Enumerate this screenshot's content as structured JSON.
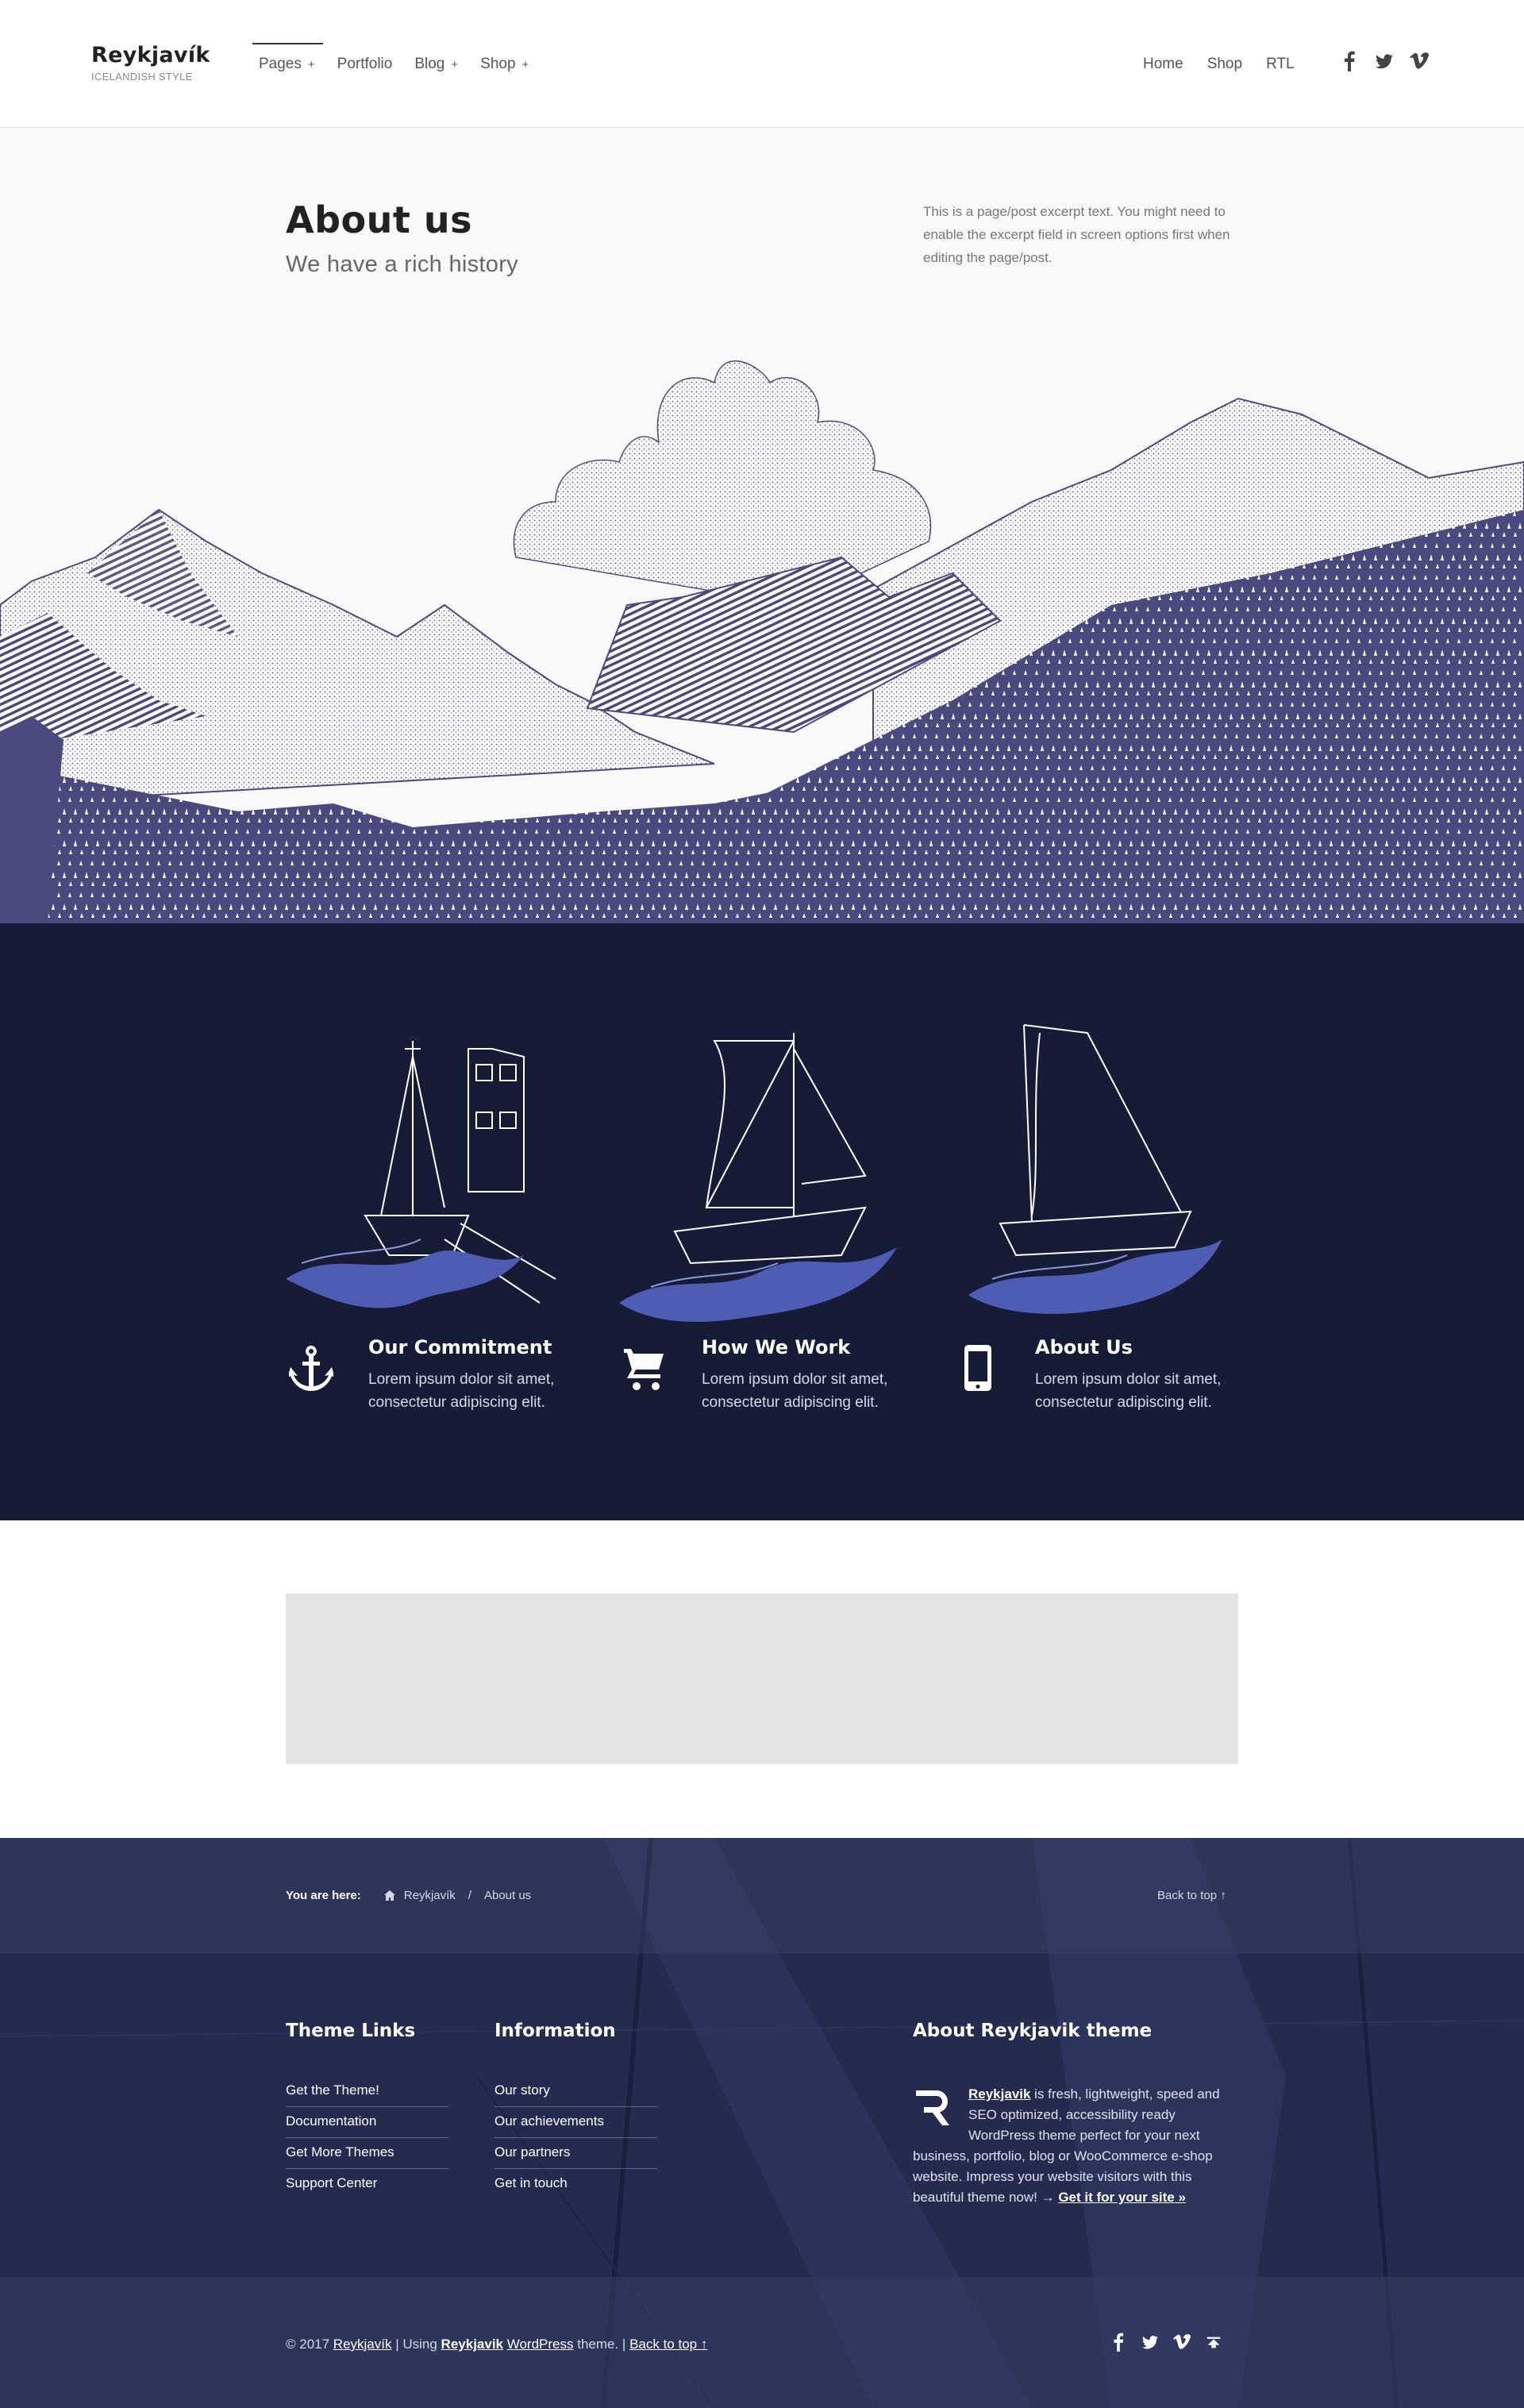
{
  "header": {
    "site_name": "Reykjavík",
    "tagline": "ICELANDISH STYLE",
    "nav": [
      {
        "label": "Pages",
        "has_submenu": true,
        "active": true
      },
      {
        "label": "Portfolio",
        "has_submenu": false
      },
      {
        "label": "Blog",
        "has_submenu": true
      },
      {
        "label": "Shop",
        "has_submenu": true
      }
    ],
    "submenu_indicator": "+",
    "secondary_nav": [
      "Home",
      "Shop",
      "RTL"
    ],
    "social": [
      "facebook-icon",
      "twitter-icon",
      "vimeo-icon"
    ]
  },
  "hero": {
    "title": "About us",
    "subtitle": "We have a rich history",
    "excerpt": "This is a page/post excerpt text. You might need to enable the excerpt field in screen options first when editing the page/post.",
    "illustration_color": "#4b4a7e",
    "background": "#f9f9f9"
  },
  "features": {
    "background": "#171c36",
    "accent": "#4e5cb4",
    "items": [
      {
        "icon": "anchor-icon",
        "title": "Our Commitment",
        "text": "Lorem ipsum dolor sit amet, consectetur adipiscing elit."
      },
      {
        "icon": "cart-icon",
        "title": "How We Work",
        "text": "Lorem ipsum dolor sit amet, consectetur adipiscing elit."
      },
      {
        "icon": "mobile-icon",
        "title": "About Us",
        "text": "Lorem ipsum dolor sit amet, consectetur adipiscing elit."
      }
    ]
  },
  "breadcrumb": {
    "prefix": "You are here:",
    "items": [
      "Reykjavík",
      "About us"
    ],
    "separator": "/",
    "back_to_top": "Back to top ↑"
  },
  "footer": {
    "columns": [
      {
        "title": "Theme Links",
        "links": [
          "Get the Theme!",
          "Documentation",
          "Get More Themes",
          "Support Center"
        ]
      },
      {
        "title": "Information",
        "links": [
          "Our story",
          "Our achievements",
          "Our partners",
          "Get in touch"
        ]
      }
    ],
    "about": {
      "title": "About Reykjavik theme",
      "brand": "Reykjavik",
      "text": " is fresh, lightweight, speed and SEO optimized, accessibility ready WordPress theme perfect for your next business, portfolio, blog or WooCommerce e-shop website. Impress your website visitors with this beautiful theme now! → ",
      "cta": "Get it for your site »"
    },
    "copyright": {
      "prefix": "© 2017 ",
      "site": "Reykjavík",
      "mid1": " | Using ",
      "theme": "Reykjavik",
      "space": " ",
      "wp": "WordPress",
      "mid2": " theme. | ",
      "back": "Back to top ↑"
    },
    "social": [
      "facebook-icon",
      "twitter-icon",
      "vimeo-icon",
      "back-to-top-icon"
    ]
  }
}
